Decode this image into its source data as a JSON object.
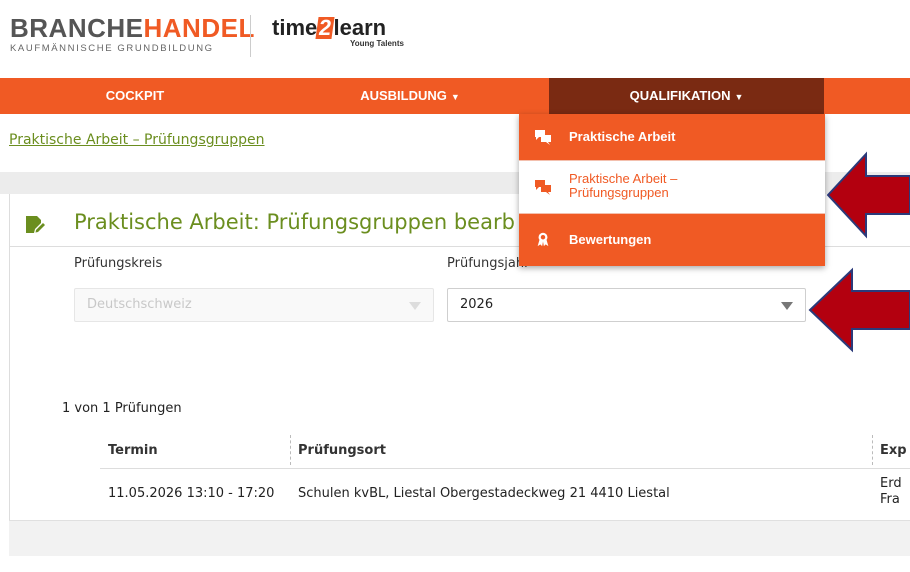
{
  "header": {
    "brand_gray": "BRANCHE",
    "brand_orange": "HANDEL",
    "brand_sub": "KAUFMÄNNISCHE GRUNDBILDUNG",
    "t2l_pre": "time",
    "t2l_num": "2",
    "t2l_post": "learn",
    "t2l_sub": "Young Talents"
  },
  "nav": {
    "cockpit": "COCKPIT",
    "ausbildung": "AUSBILDUNG",
    "qualifikation": "QUALIFIKATION",
    "caret": "▼"
  },
  "dropdown": {
    "items": [
      {
        "label": "Praktische Arbeit",
        "icon": "chat-bubbles-icon"
      },
      {
        "label_line1": "Praktische Arbeit –",
        "label_line2": "Prüfungsgruppen",
        "icon": "chat-bubbles-icon"
      },
      {
        "label": "Bewertungen",
        "icon": "award-medal-icon"
      }
    ]
  },
  "breadcrumb": "Praktische Arbeit – Prüfungsgruppen",
  "card": {
    "title": "Praktische Arbeit: Prüfungsgruppen bearb",
    "label_kreis": "Prüfungskreis",
    "label_jahr": "Prüfungsjahr",
    "kreis_value": "Deutschschweiz",
    "jahr_value": "2026",
    "count": "1 von 1 Prüfungen"
  },
  "table": {
    "headers": [
      "Termin",
      "Prüfungsort",
      "Exp"
    ],
    "rows": [
      {
        "termin": "11.05.2026 13:10 - 17:20",
        "ort": "Schulen kvBL, Liestal Obergestadeckweg 21 4410 Liestal",
        "exp_line1": "Erd",
        "exp_line2": "Fra"
      }
    ]
  },
  "colors": {
    "brand_orange": "#f05a24",
    "active_nav": "#7a2a12",
    "link_green": "#6b8e1f",
    "annotation_arrow": "#b3000f"
  }
}
